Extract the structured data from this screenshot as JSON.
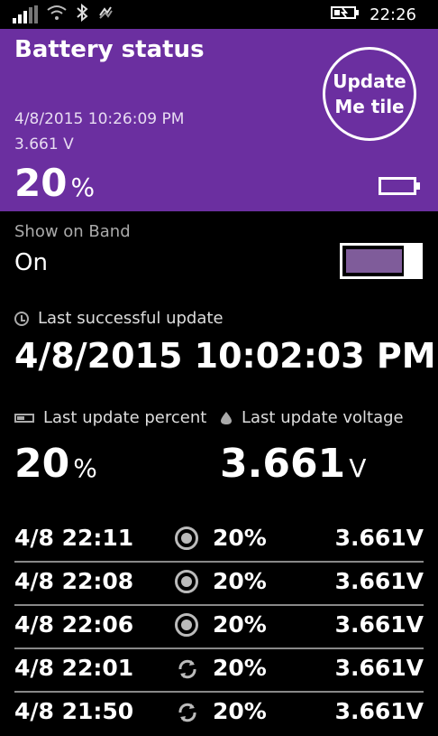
{
  "status_bar": {
    "time": "22:26",
    "icons": [
      "signal-icon",
      "wifi-icon",
      "bluetooth-icon",
      "data-sense-icon",
      "battery-charging-icon"
    ]
  },
  "header": {
    "title": "Battery status",
    "timestamp": "4/8/2015 10:26:09 PM",
    "voltage": "3.661 V",
    "percent": "20",
    "percent_unit": "%",
    "update_tile_line1": "Update",
    "update_tile_line2": "Me tile",
    "background_color": "#6b2fa0"
  },
  "band": {
    "label": "Show on Band",
    "value": "On",
    "toggle_on": true
  },
  "last_success": {
    "label": "Last successful update",
    "value": "4/8/2015 10:02:03 PM"
  },
  "last_update": {
    "percent_label": "Last update percent",
    "percent_value": "20",
    "percent_unit": "%",
    "voltage_label": "Last update voltage",
    "voltage_value": "3.661",
    "voltage_unit": "V"
  },
  "history": [
    {
      "time": "4/8 22:11",
      "icon": "radio-icon",
      "percent": "20%",
      "voltage": "3.661V"
    },
    {
      "time": "4/8 22:08",
      "icon": "radio-icon",
      "percent": "20%",
      "voltage": "3.661V"
    },
    {
      "time": "4/8 22:06",
      "icon": "radio-icon",
      "percent": "20%",
      "voltage": "3.661V"
    },
    {
      "time": "4/8 22:01",
      "icon": "sync-icon",
      "percent": "20%",
      "voltage": "3.661V"
    },
    {
      "time": "4/8 21:50",
      "icon": "sync-icon",
      "percent": "20%",
      "voltage": "3.661V"
    }
  ]
}
